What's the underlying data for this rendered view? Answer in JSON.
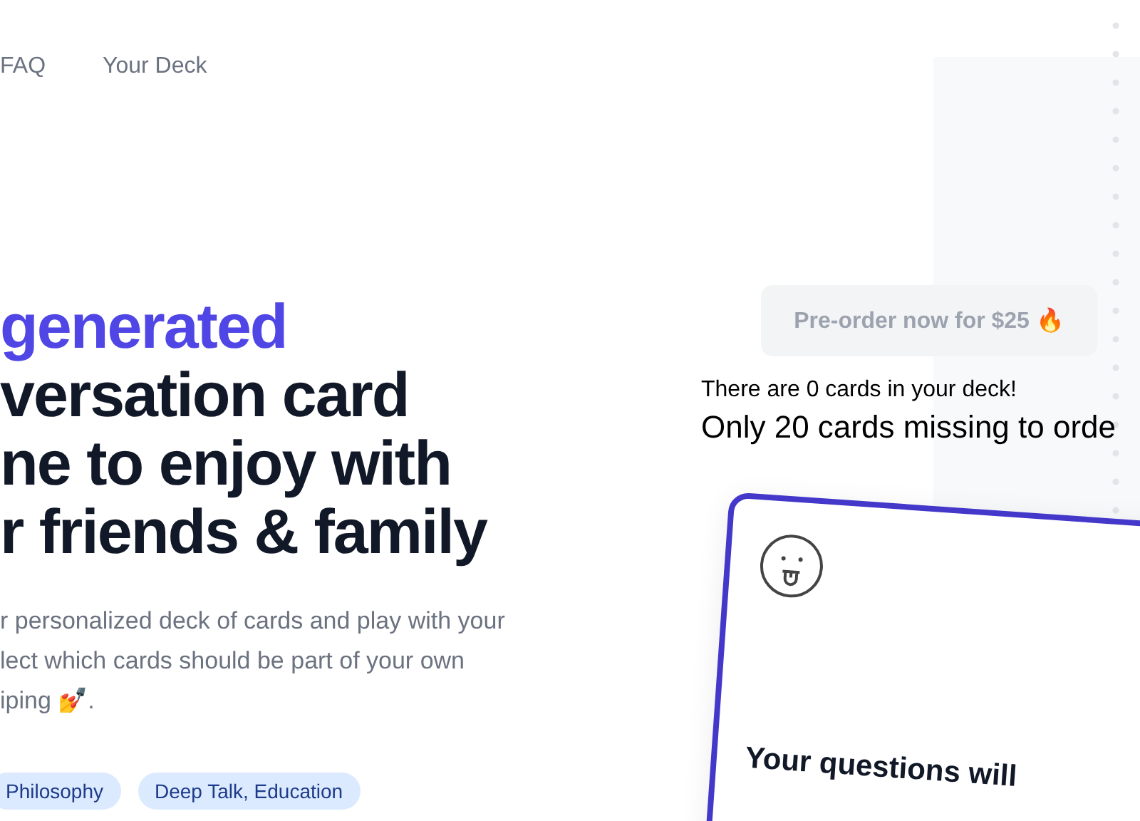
{
  "nav": [
    {
      "label": "FAQ"
    },
    {
      "label": "Your Deck"
    }
  ],
  "headline": {
    "highlight": "generated",
    "lines": [
      "versation card",
      "ne to enjoy with",
      "r friends & family"
    ]
  },
  "description": [
    "r personalized deck of cards and play with your",
    "lect which cards should be part of your own",
    "iping 💅."
  ],
  "tags": [
    "Philosophy",
    "Deep Talk, Education"
  ],
  "preorder_button": {
    "label": "Pre-order now for $25 🔥",
    "disabled": true
  },
  "deck_count": "There are 0 cards in your deck!",
  "missing_note": "Only 20 cards missing to orde",
  "card": {
    "text": "Your questions will"
  }
}
